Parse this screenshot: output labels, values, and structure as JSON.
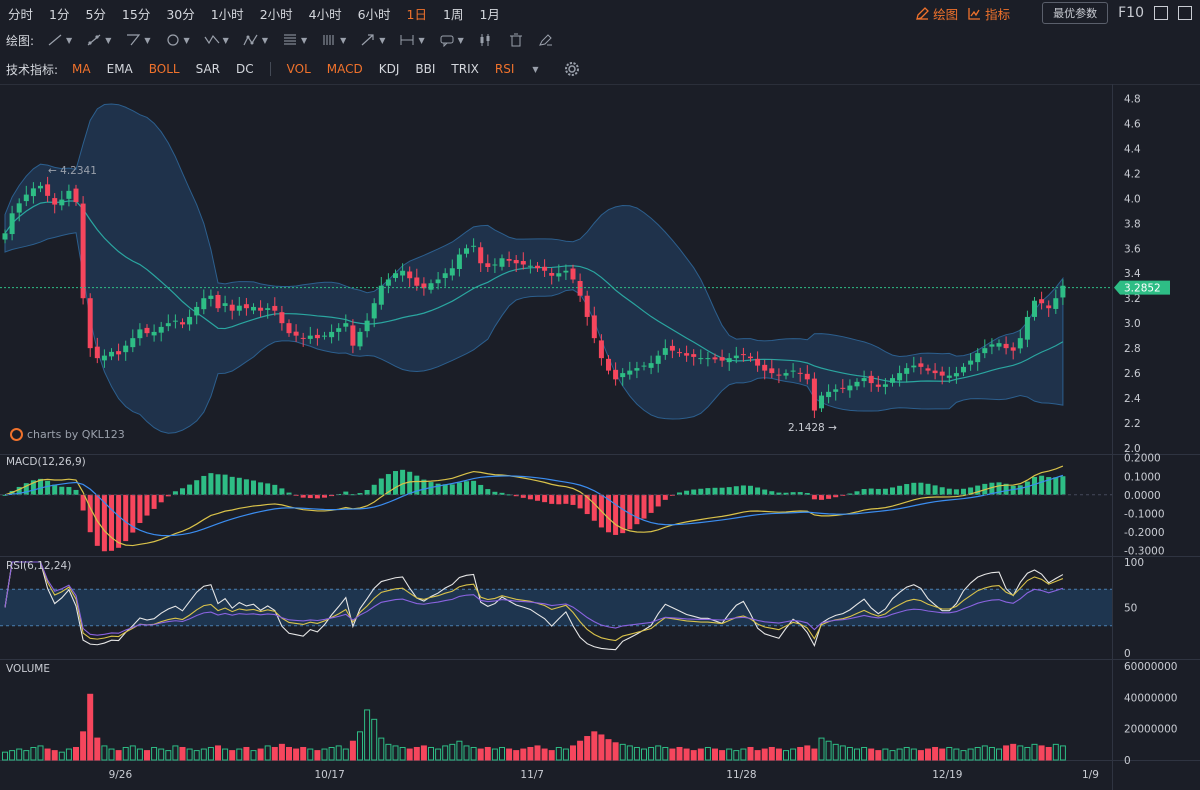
{
  "periods": [
    "分时",
    "1分",
    "5分",
    "15分",
    "30分",
    "1小时",
    "2小时",
    "4小时",
    "6小时",
    "1日",
    "1周",
    "1月"
  ],
  "active_period": "1日",
  "toolbar_right": {
    "draw_label": "绘图",
    "indicator_label": "指标",
    "params_label": "最优参数",
    "f10_label": "F10"
  },
  "draw_label": "绘图:",
  "indicator_bar": {
    "label": "技术指标:",
    "main": [
      {
        "name": "MA",
        "on": true
      },
      {
        "name": "EMA",
        "on": false
      },
      {
        "name": "BOLL",
        "on": true
      },
      {
        "name": "SAR",
        "on": false
      },
      {
        "name": "DC",
        "on": false
      }
    ],
    "sub": [
      {
        "name": "VOL",
        "on": true
      },
      {
        "name": "MACD",
        "on": true
      },
      {
        "name": "KDJ",
        "on": false
      },
      {
        "name": "BBI",
        "on": false
      },
      {
        "name": "TRIX",
        "on": false
      },
      {
        "name": "RSI",
        "on": true
      }
    ]
  },
  "brand": "charts by QKL123",
  "colors": {
    "up": "#2ebd85",
    "down": "#f6465d",
    "bb": "#22446a",
    "mid": "#2aa6a0",
    "dif": "#d9c24a",
    "dea": "#3b8df0",
    "rsi6": "#e6e6e6",
    "rsi12": "#d9c24a",
    "rsi24": "#8a63e0"
  },
  "chart_data": [
    {
      "type": "candlestick",
      "panel": "price",
      "ylim": [
        2.0,
        4.9
      ],
      "yticks": [
        "4.8",
        "4.6",
        "4.4",
        "4.2",
        "4.0",
        "3.8",
        "3.6",
        "3.4",
        "3.2",
        "3.0",
        "2.8",
        "2.6",
        "2.4",
        "2.2",
        "2.0"
      ],
      "x_ticks": [
        "9/26",
        "10/17",
        "11/7",
        "11/28",
        "12/19",
        "1/9"
      ],
      "close": [
        3.72,
        3.88,
        3.96,
        4.03,
        4.08,
        4.1,
        4.02,
        3.95,
        3.99,
        4.06,
        3.97,
        3.2,
        2.8,
        2.72,
        2.74,
        2.77,
        2.75,
        2.82,
        2.88,
        2.95,
        2.92,
        2.93,
        2.97,
        3.0,
        3.02,
        2.99,
        3.05,
        3.13,
        3.2,
        3.22,
        3.12,
        3.16,
        3.1,
        3.14,
        3.12,
        3.13,
        3.1,
        3.12,
        3.1,
        3.0,
        2.92,
        2.9,
        2.88,
        2.9,
        2.88,
        2.9,
        2.93,
        2.96,
        3.0,
        2.82,
        2.93,
        3.02,
        3.16,
        3.3,
        3.35,
        3.4,
        3.42,
        3.36,
        3.3,
        3.28,
        3.32,
        3.35,
        3.4,
        3.44,
        3.55,
        3.6,
        3.62,
        3.48,
        3.45,
        3.47,
        3.52,
        3.5,
        3.48,
        3.47,
        3.46,
        3.44,
        3.42,
        3.38,
        3.4,
        3.42,
        3.35,
        3.22,
        3.05,
        2.88,
        2.72,
        2.62,
        2.55,
        2.6,
        2.62,
        2.64,
        2.66,
        2.68,
        2.74,
        2.8,
        2.78,
        2.76,
        2.74,
        2.73,
        2.72,
        2.72,
        2.71,
        2.7,
        2.72,
        2.74,
        2.75,
        2.72,
        2.66,
        2.62,
        2.6,
        2.58,
        2.6,
        2.62,
        2.6,
        2.55,
        2.3,
        2.42,
        2.45,
        2.47,
        2.48,
        2.5,
        2.53,
        2.56,
        2.52,
        2.49,
        2.51,
        2.56,
        2.6,
        2.64,
        2.66,
        2.65,
        2.62,
        2.6,
        2.58,
        2.58,
        2.6,
        2.65,
        2.7,
        2.76,
        2.8,
        2.83,
        2.84,
        2.8,
        2.78,
        2.88,
        3.05,
        3.18,
        3.16,
        3.12,
        3.2,
        3.3
      ],
      "annotations": [
        {
          "text": "4.2341",
          "type": "high"
        },
        {
          "text": "2.1428",
          "type": "low"
        },
        {
          "text": "3.2852",
          "type": "last"
        }
      ]
    },
    {
      "type": "bar+line",
      "panel": "MACD",
      "title": "MACD(12,26,9)",
      "ylim": [
        -0.33,
        0.22
      ],
      "yticks": [
        "0.2000",
        "0.1000",
        "0.0000",
        "-0.1000",
        "-0.2000",
        "-0.3000"
      ]
    },
    {
      "type": "line",
      "panel": "RSI",
      "title": "RSI(6,12,24)",
      "ylim": [
        0,
        100
      ],
      "yticks": [
        "100",
        "50",
        "0"
      ],
      "bands": [
        30,
        70
      ]
    },
    {
      "type": "bar",
      "panel": "VOLUME",
      "title": "VOLUME",
      "ylim": [
        0,
        62000000
      ],
      "yticks": [
        "60000000",
        "40000000",
        "20000000",
        "0"
      ],
      "volume": [
        5,
        6,
        7,
        6,
        8,
        9,
        7,
        6,
        5,
        7,
        8,
        18,
        42,
        14,
        9,
        7,
        6,
        8,
        9,
        7,
        6,
        8,
        7,
        6,
        9,
        8,
        7,
        6,
        7,
        8,
        9,
        7,
        6,
        7,
        8,
        6,
        7,
        9,
        8,
        10,
        8,
        7,
        8,
        7,
        6,
        7,
        8,
        9,
        7,
        12,
        18,
        32,
        26,
        14,
        10,
        9,
        8,
        7,
        8,
        9,
        8,
        7,
        9,
        10,
        12,
        9,
        8,
        7,
        8,
        7,
        8,
        7,
        6,
        7,
        8,
        9,
        7,
        6,
        8,
        7,
        9,
        12,
        15,
        18,
        16,
        13,
        11,
        10,
        9,
        8,
        7,
        8,
        9,
        8,
        7,
        8,
        7,
        6,
        7,
        8,
        7,
        6,
        7,
        6,
        7,
        8,
        6,
        7,
        8,
        7,
        6,
        7,
        8,
        9,
        7,
        14,
        12,
        10,
        9,
        8,
        7,
        8,
        7,
        6,
        7,
        6,
        7,
        8,
        7,
        6,
        7,
        8,
        7,
        8,
        7,
        6,
        7,
        8,
        9,
        8,
        7,
        9,
        10,
        9,
        8,
        10,
        9,
        8,
        10,
        9
      ]
    }
  ]
}
